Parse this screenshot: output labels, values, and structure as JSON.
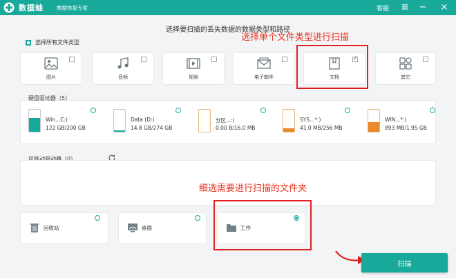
{
  "app": {
    "name": "数据蛙",
    "slogan": "数据恢复专家"
  },
  "window": {
    "support": "客服"
  },
  "instruction": "选择要扫描的丢失数据的数据类型和路径",
  "select_all": {
    "label": "选择所有文件类型"
  },
  "file_types": [
    {
      "label": "图片",
      "icon": "image-icon",
      "checked": false
    },
    {
      "label": "音频",
      "icon": "music-icon",
      "checked": false
    },
    {
      "label": "视频",
      "icon": "video-icon",
      "checked": false
    },
    {
      "label": "电子邮件",
      "icon": "mail-icon",
      "checked": false
    },
    {
      "label": "文档",
      "icon": "document-icon",
      "checked": true
    },
    {
      "label": "其它",
      "icon": "other-icon",
      "checked": false
    }
  ],
  "hard_drives": {
    "label": "硬盘驱动器（5）",
    "items": [
      {
        "name": "Win...C:)",
        "size": "122 GB/200 GB",
        "used_fraction": 0.61,
        "color": "#19a99b",
        "selected": false
      },
      {
        "name": "Data (D:)",
        "size": "14.8 GB/274 GB",
        "used_fraction": 0.05,
        "color": "#19a99b",
        "selected": false
      },
      {
        "name": "分区...:)",
        "size": "0.00  B/16.0 MB",
        "used_fraction": 0.0,
        "color": "#e8892b",
        "selected": false
      },
      {
        "name": "SYS...*:)",
        "size": "41.0 MB/256 MB",
        "used_fraction": 0.16,
        "color": "#e8892b",
        "selected": false
      },
      {
        "name": "WIN...*:)",
        "size": "893 MB/1.95 GB",
        "used_fraction": 0.45,
        "color": "#e8892b",
        "selected": false
      }
    ]
  },
  "removable": {
    "label": "可移动驱动器（0）"
  },
  "locations": [
    {
      "label": "回收站",
      "icon": "recycle-bin-icon",
      "selected": false
    },
    {
      "label": "桌面",
      "icon": "desktop-icon",
      "selected": false
    },
    {
      "label": "工作",
      "icon": "folder-icon",
      "selected": true
    }
  ],
  "annotations": {
    "select_type": "选择单个文件类型进行扫描",
    "select_folder": "细选需要进行扫描的文件夹"
  },
  "scan_button": "扫描",
  "colors": {
    "brand": "#19a99b",
    "annotation": "#e02020",
    "drive_warn": "#e8892b"
  }
}
